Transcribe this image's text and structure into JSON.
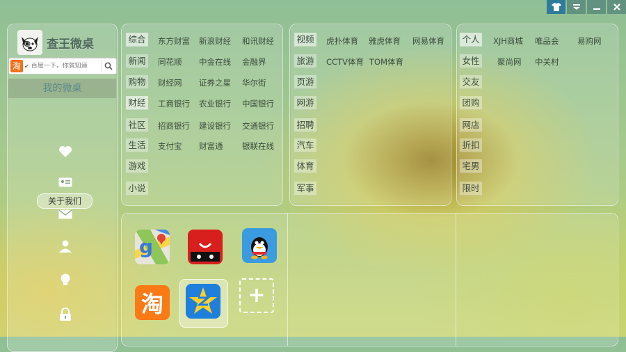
{
  "window": {
    "buttons": [
      "skin",
      "dropdown",
      "minimize",
      "close"
    ]
  },
  "brand": {
    "title": "查王微桌"
  },
  "search": {
    "placeholder": "百度一下，你就知道"
  },
  "sidebar": {
    "my_desk": "我的微桌",
    "tooltip": "关于我们",
    "icons": [
      "heart-icon",
      "contact-card-icon",
      "mail-icon",
      "user-icon",
      "lightbulb-icon",
      "lock-icon"
    ]
  },
  "panel1": {
    "categories": [
      "综合",
      "新闻",
      "购物",
      "财经",
      "社区",
      "生活",
      "游戏",
      "小说"
    ],
    "rows": [
      [
        "东方财富",
        "新浪财经",
        "和讯财经"
      ],
      [
        "同花顺",
        "中金在线",
        "金融界"
      ],
      [
        "财经网",
        "证券之星",
        "华尔街"
      ],
      [
        "工商银行",
        "农业银行",
        "中国银行"
      ],
      [
        "招商银行",
        "建设银行",
        "交通银行"
      ],
      [
        "支付宝",
        "财富通",
        "银联在线"
      ]
    ]
  },
  "panel2": {
    "categories": [
      "视频",
      "旅游",
      "页游",
      "网游",
      "招聘",
      "汽车",
      "体育",
      "军事"
    ],
    "rows": [
      [
        "虎扑体育",
        "雅虎体育",
        "网易体育"
      ],
      [
        "CCTV体育",
        "TOM体育"
      ]
    ]
  },
  "panel3": {
    "categories": [
      "个人",
      "女性",
      "交友",
      "团购",
      "网店",
      "折扣",
      "宅男",
      "限时"
    ],
    "rows": [
      [
        "XJH商城",
        "唯品会",
        "易购网"
      ],
      [
        "聚尚网",
        "中关村"
      ]
    ]
  },
  "apps": [
    {
      "name": "google-maps",
      "label": "g"
    },
    {
      "name": "tmall",
      "label": ""
    },
    {
      "name": "qq",
      "label": ""
    },
    {
      "name": "taobao",
      "label": "淘"
    },
    {
      "name": "qzone",
      "label": ""
    },
    {
      "name": "add",
      "label": "+"
    }
  ],
  "colors": {
    "accent": "#2f7b9a",
    "taobao": "#f2711c"
  }
}
